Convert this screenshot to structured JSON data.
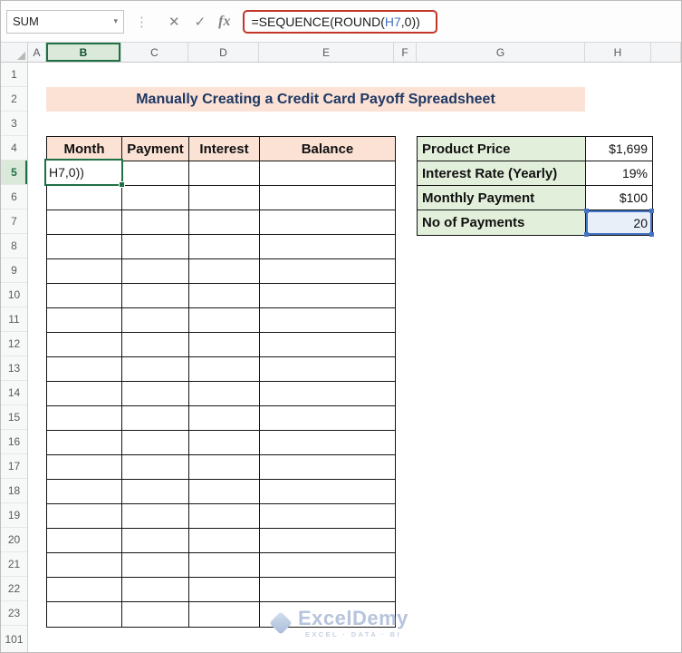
{
  "formula_bar": {
    "name_box": "SUM",
    "icons": {
      "chevron": "▾",
      "separator": "⋮",
      "cancel": "✕",
      "enter": "✓",
      "fx": "fx"
    },
    "formula_prefix": "=SEQUENCE(ROUND(",
    "formula_ref": "H7",
    "formula_suffix": ",0))"
  },
  "columns": [
    "A",
    "B",
    "C",
    "D",
    "E",
    "F",
    "G",
    "H"
  ],
  "rows": [
    "1",
    "2",
    "3",
    "4",
    "5",
    "6",
    "7",
    "8",
    "9",
    "10",
    "11",
    "12",
    "13",
    "14",
    "15",
    "16",
    "17",
    "18",
    "19",
    "20",
    "21",
    "22",
    "23",
    "101"
  ],
  "title": "Manually Creating a Credit Card Payoff Spreadsheet",
  "payoff_table": {
    "headers": [
      "Month",
      "Payment",
      "Interest",
      "Balance"
    ],
    "editing_cell_text": "H7,0))"
  },
  "inputs_table": {
    "rows": [
      {
        "label": "Product Price",
        "value": "$1,699"
      },
      {
        "label": "Interest Rate (Yearly)",
        "value": "19%"
      },
      {
        "label": "Monthly Payment",
        "value": "$100"
      },
      {
        "label": "No of Payments",
        "value": "20"
      }
    ]
  },
  "watermark": {
    "name": "ExcelDemy",
    "tagline": "EXCEL · DATA · BI"
  },
  "colors": {
    "annotation_red": "#c23528",
    "selection_green": "#1e7145",
    "reference_blue": "#4472c4",
    "reference_fill": "#e9eff9",
    "header_peach": "#fbe2d5",
    "label_green": "#e2efda",
    "title_navy": "#1f3864",
    "watermark_blue": "#b7c4dc"
  }
}
